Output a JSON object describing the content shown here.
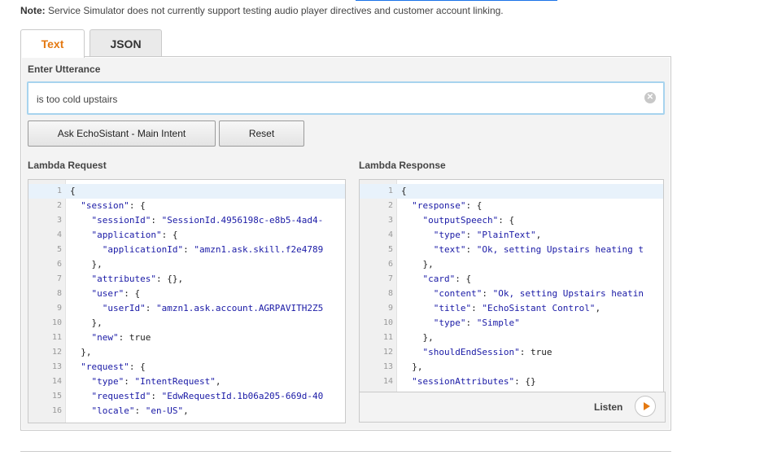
{
  "note": {
    "prefix": "Note:",
    "text": " Service Simulator does not currently support testing audio player directives and customer account linking."
  },
  "tabs": [
    {
      "label": "Text",
      "active": true
    },
    {
      "label": "JSON",
      "active": false
    }
  ],
  "utterance": {
    "label": "Enter Utterance",
    "value": "is too cold upstairs"
  },
  "buttons": {
    "ask": "Ask EchoSistant - Main Intent",
    "reset": "Reset"
  },
  "request": {
    "title": "Lambda Request",
    "lines": [
      "{",
      "  \"session\": {",
      "    \"sessionId\": \"SessionId.4956198c-e8b5-4ad4-",
      "    \"application\": {",
      "      \"applicationId\": \"amzn1.ask.skill.f2e4789",
      "    },",
      "    \"attributes\": {},",
      "    \"user\": {",
      "      \"userId\": \"amzn1.ask.account.AGRPAVITH2Z5",
      "    },",
      "    \"new\": true",
      "  },",
      "  \"request\": {",
      "    \"type\": \"IntentRequest\",",
      "    \"requestId\": \"EdwRequestId.1b06a205-669d-40",
      "    \"locale\": \"en-US\","
    ]
  },
  "response": {
    "title": "Lambda Response",
    "lines": [
      "{",
      "  \"response\": {",
      "    \"outputSpeech\": {",
      "      \"type\": \"PlainText\",",
      "      \"text\": \"Ok, setting Upstairs heating t",
      "    },",
      "    \"card\": {",
      "      \"content\": \"Ok, setting Upstairs heatin",
      "      \"title\": \"EchoSistant Control\",",
      "      \"type\": \"Simple\"",
      "    },",
      "    \"shouldEndSession\": true",
      "  },",
      "  \"sessionAttributes\": {}"
    ]
  },
  "listen": {
    "label": "Listen"
  },
  "colors": {
    "accent": "#e47911",
    "focus_border": "#a7d3ee",
    "code_key": "#1a1aa6"
  }
}
